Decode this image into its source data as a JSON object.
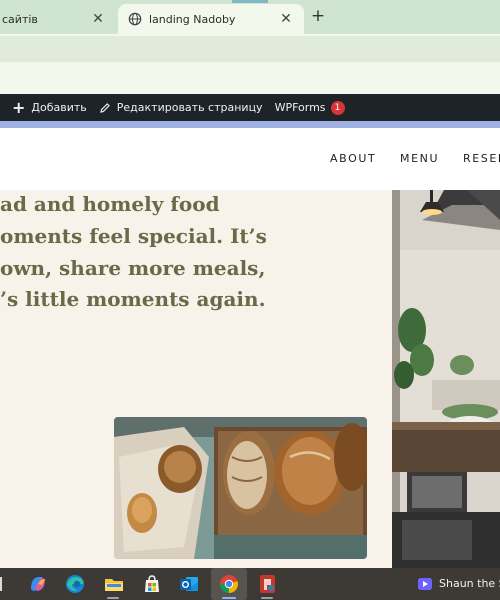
{
  "browser": {
    "tabs": [
      {
        "title": "сайтів",
        "active": false
      },
      {
        "title": "landing Nadoby",
        "active": true
      }
    ],
    "close_glyph": "✕",
    "new_tab_glyph": "+"
  },
  "admin_bar": {
    "add_label": "Добавить",
    "edit_page_label": "Редактировать страницу",
    "wpforms_label": "WPForms",
    "wpforms_badge": "1"
  },
  "site_nav": {
    "items": [
      "ABOUT",
      "MENU",
      "RESER"
    ]
  },
  "hero": {
    "lines": [
      "ad and homely food",
      "oments feel special. It’s",
      "own, share more meals,",
      "’s little moments again."
    ]
  },
  "taskbar": {
    "notification_title": "Shaun the Sl",
    "icons": [
      "copilot-icon",
      "edge-icon",
      "file-explorer-icon",
      "microsoft-store-icon",
      "outlook-icon",
      "chrome-icon",
      "app-icon"
    ]
  },
  "colors": {
    "admin_bar": "#1d2327",
    "hero_bg": "#f8f2ea",
    "hero_text": "#6a6948",
    "badge": "#d63638",
    "taskbar": "#3d3a36"
  }
}
